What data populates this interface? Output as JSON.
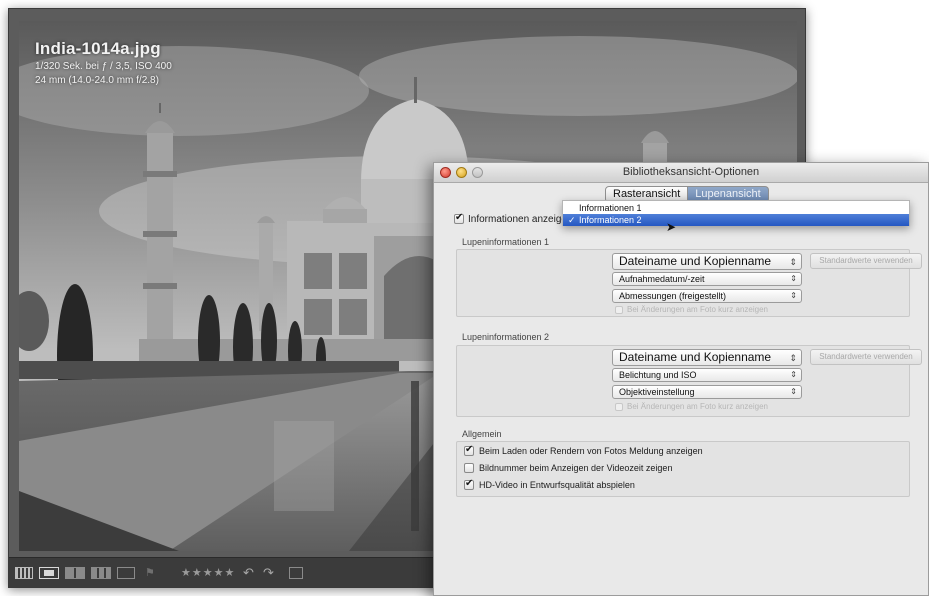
{
  "photo": {
    "title": "India-1014a.jpg",
    "meta_line_1": "1/320 Sek. bei ƒ / 3,5, ISO 400",
    "meta_line_2": "24 mm (14.0-24.0 mm f/2.8)"
  },
  "toolbar": {
    "stars": "★★★★★",
    "rotate_left": "↶",
    "rotate_right": "↷",
    "flag": "⚑"
  },
  "dialog": {
    "title": "Bibliotheksansicht-Optionen",
    "tabs": [
      {
        "label": "Rasteransicht",
        "active": true
      },
      {
        "label": "Lupenansicht",
        "active": false
      }
    ],
    "show_info_label": "Informationen anzeigen:",
    "show_info_checked": true,
    "dropdown": {
      "items": [
        {
          "label": "Informationen 1",
          "selected": false
        },
        {
          "label": "Informationen 2",
          "selected": true
        }
      ],
      "check_mark": "✓"
    },
    "loupe_info_1": {
      "section_label": "Lupeninformationen 1",
      "field_1": "Dateiname und Kopienname",
      "field_2": "Aufnahmedatum/-zeit",
      "field_3": "Abmessungen (freigestellt)",
      "option_label": "Bei Änderungen am Foto kurz anzeigen",
      "option_checked": false,
      "default_button": "Standardwerte verwenden"
    },
    "loupe_info_2": {
      "section_label": "Lupeninformationen 2",
      "field_1": "Dateiname und Kopienname",
      "field_2": "Belichtung und ISO",
      "field_3": "Objektiveinstellung",
      "option_label": "Bei Änderungen am Foto kurz anzeigen",
      "option_checked": false,
      "default_button": "Standardwerte verwenden"
    },
    "general": {
      "section_label": "Allgemein",
      "options": [
        {
          "label": "Beim Laden oder Rendern von Fotos Meldung anzeigen",
          "checked": true
        },
        {
          "label": "Bildnummer beim Anzeigen der Videozeit zeigen",
          "checked": false
        },
        {
          "label": "HD-Video in Entwurfsqualität abspielen",
          "checked": true
        }
      ]
    },
    "popup_arrows": "⇕"
  }
}
